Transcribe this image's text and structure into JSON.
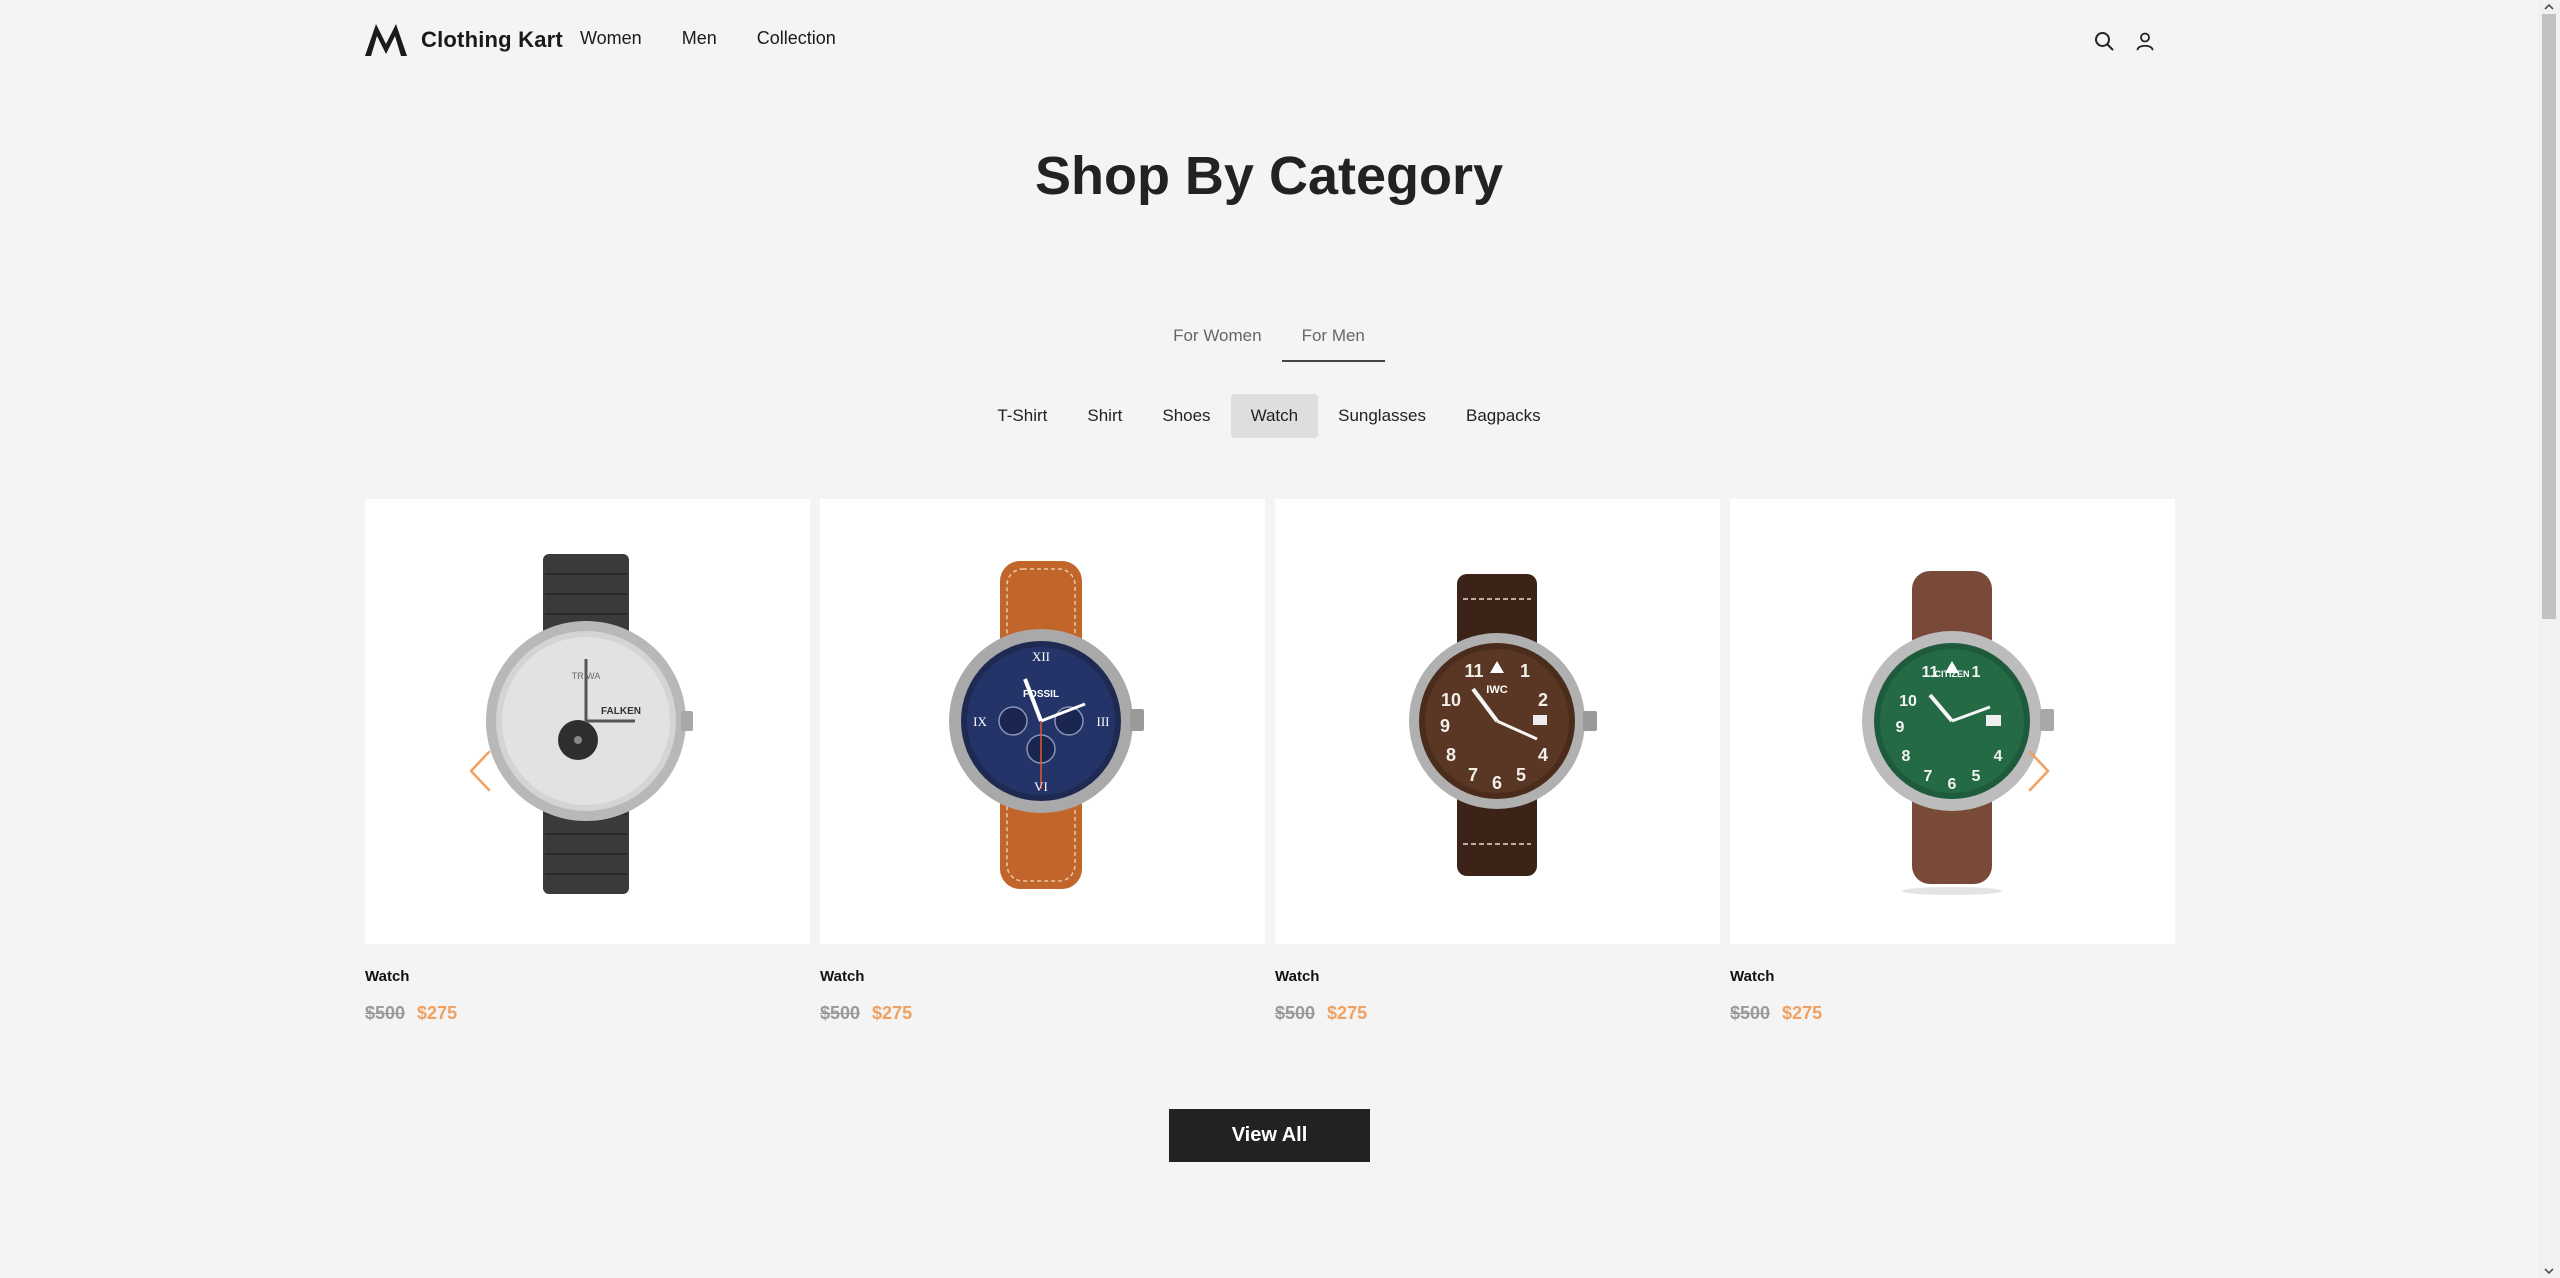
{
  "brand": {
    "name": "Clothing Kart",
    "logo_icon": "m-monogram-icon"
  },
  "nav": {
    "items": [
      "Women",
      "Men",
      "Collection"
    ]
  },
  "header_icons": {
    "search": "search-icon",
    "account": "user-icon"
  },
  "page": {
    "title": "Shop By Category"
  },
  "gender_tabs": {
    "items": [
      "For Women",
      "For Men"
    ],
    "active": "For Men"
  },
  "categories": {
    "items": [
      "T-Shirt",
      "Shirt",
      "Shoes",
      "Watch",
      "Sunglasses",
      "Bagpacks"
    ],
    "active": "Watch"
  },
  "products": [
    {
      "title": "Watch",
      "old_price": "$500",
      "new_price": "$275",
      "image": "watch-black-nylon-strap"
    },
    {
      "title": "Watch",
      "old_price": "$500",
      "new_price": "$275",
      "image": "watch-blue-chronograph-tan-leather"
    },
    {
      "title": "Watch",
      "old_price": "$500",
      "new_price": "$275",
      "image": "watch-brown-dial-pilot"
    },
    {
      "title": "Watch",
      "old_price": "$500",
      "new_price": "$275",
      "image": "watch-green-dial-brown-leather"
    }
  ],
  "carousel": {
    "prev_icon": "chevron-left-icon",
    "next_icon": "chevron-right-icon"
  },
  "cta": {
    "view_all_label": "View All"
  },
  "colors": {
    "accent": "#f0a060",
    "dark": "#222222",
    "background": "#f4f4f4",
    "active_pill": "#dedede"
  }
}
